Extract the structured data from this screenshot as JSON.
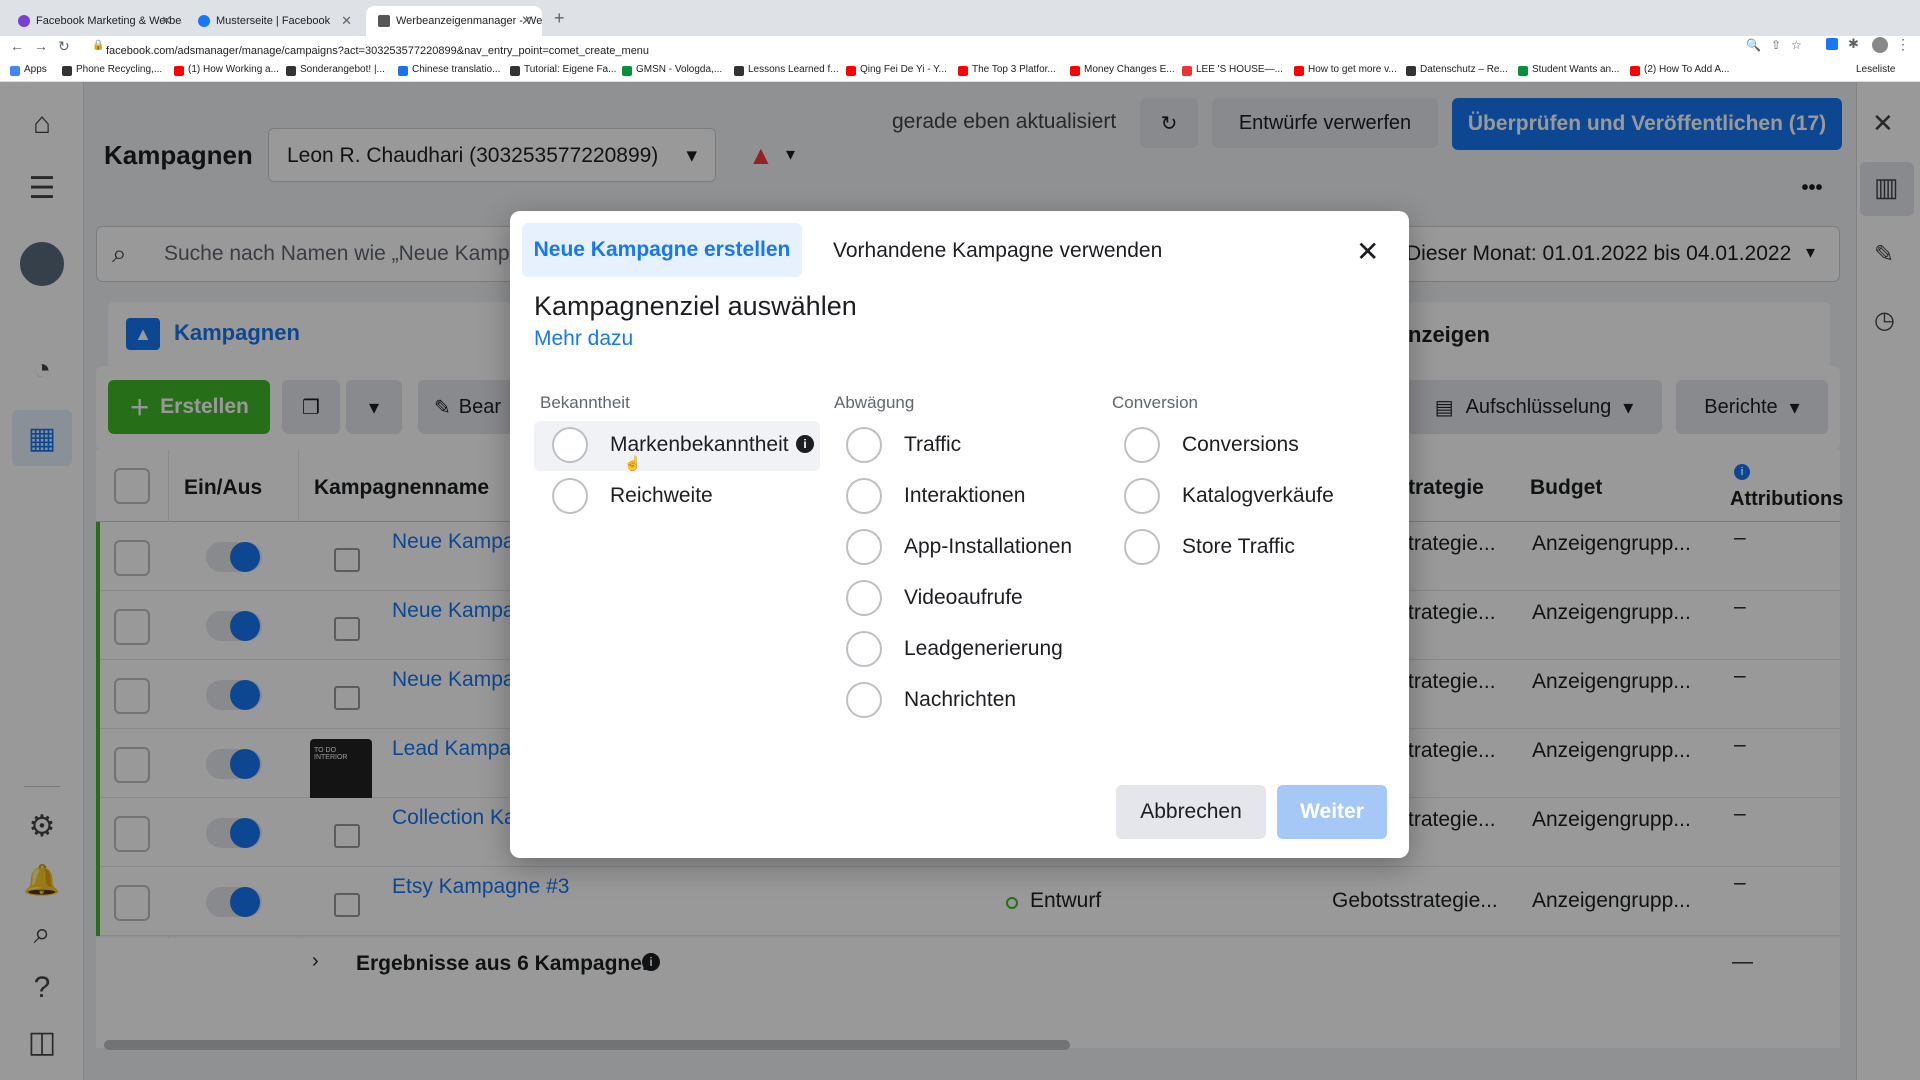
{
  "browser": {
    "tabs": [
      {
        "title": "Facebook Marketing & Werbea",
        "color": "#7a3fd0"
      },
      {
        "title": "Musterseite | Facebook",
        "color": "#1877f2"
      },
      {
        "title": "Werbeanzeigenmanager - Wer",
        "color": "#555"
      }
    ],
    "new_tab": "+",
    "url": "facebook.com/adsmanager/manage/campaigns?act=303253577220899&nav_entry_point=comet_create_menu",
    "bookmarks": [
      {
        "label": "Apps",
        "color": "#4285f4"
      },
      {
        "label": "Phone Recycling,...",
        "color": "#333"
      },
      {
        "label": "(1) How Working a...",
        "color": "#ff0000"
      },
      {
        "label": "Sonderangebot! |...",
        "color": "#333"
      },
      {
        "label": "Chinese translatio...",
        "color": "#1a73e8"
      },
      {
        "label": "Tutorial: Eigene Fa...",
        "color": "#333"
      },
      {
        "label": "GMSN - Vologda,...",
        "color": "#0a8f3c"
      },
      {
        "label": "Lessons Learned f...",
        "color": "#333"
      },
      {
        "label": "Qing Fei De Yi - Y...",
        "color": "#ff0000"
      },
      {
        "label": "The Top 3 Platfor...",
        "color": "#ff0000"
      },
      {
        "label": "Money Changes E...",
        "color": "#ff0000"
      },
      {
        "label": "LEE 'S HOUSE—...",
        "color": "#e33"
      },
      {
        "label": "How to get more v...",
        "color": "#ff0000"
      },
      {
        "label": "Datenschutz – Re...",
        "color": "#333"
      },
      {
        "label": "Student Wants an...",
        "color": "#0a8f3c"
      },
      {
        "label": "(2) How To Add A...",
        "color": "#ff0000"
      }
    ],
    "reading_list": "Leseliste"
  },
  "header": {
    "title": "Kampagnen",
    "account": "Leon R. Chaudhari (303253577220899)",
    "status": "gerade eben aktualisiert",
    "discard": "Entwürfe verwerfen",
    "publish": "Überprüfen und Veröffentlichen (17)",
    "more": "•••"
  },
  "search": {
    "placeholder": "Suche nach Namen wie „Neue Kampa",
    "date_range": "Dieser Monat: 01.01.2022 bis 04.01.2022"
  },
  "tabs": {
    "campaigns": "Kampagnen",
    "ads": "nzeigen"
  },
  "toolbar": {
    "create": "Erstellen",
    "edit": "Bear",
    "breakdown": "Aufschlüsselung",
    "reports": "Berichte"
  },
  "table": {
    "headers": {
      "onoff": "Ein/Aus",
      "name": "Kampagnenname",
      "strategy": "trategie",
      "budget": "Budget",
      "attribution": "Attributions"
    },
    "rows": [
      {
        "name": "Neue Kampa",
        "strategy": "trategie...",
        "budget": "Anzeigengrupp...",
        "attr": "–"
      },
      {
        "name": "Neue Kampa",
        "strategy": "trategie...",
        "budget": "Anzeigengrupp...",
        "attr": "–"
      },
      {
        "name": "Neue Kampa",
        "strategy": "trategie...",
        "budget": "Anzeigengrupp...",
        "attr": "–"
      },
      {
        "name": "Lead Kampa",
        "strategy": "trategie...",
        "budget": "Anzeigengrupp...",
        "attr": "–"
      },
      {
        "name": "Collection Ka",
        "strategy": "trategie...",
        "budget": "Anzeigengrupp...",
        "attr": "–"
      },
      {
        "name": "Etsy Kampagne #3",
        "status": "Entwurf",
        "strategy": "Gebotsstrategie...",
        "budget": "Anzeigengrupp...",
        "attr": "–"
      }
    ],
    "summary": "Ergebnisse aus 6 Kampagnen",
    "summary_attr": "—",
    "thumb_text": "TO DO INTERIOR"
  },
  "modal": {
    "tab_new": "Neue Kampagne erstellen",
    "tab_existing": "Vorhandene Kampagne verwenden",
    "heading": "Kampagnenziel auswählen",
    "learn_more": "Mehr dazu",
    "groups": [
      {
        "label": "Bekanntheit",
        "options": [
          "Markenbekanntheit",
          "Reichweite"
        ]
      },
      {
        "label": "Abwägung",
        "options": [
          "Traffic",
          "Interaktionen",
          "App-Installationen",
          "Videoaufrufe",
          "Leadgenerierung",
          "Nachrichten"
        ]
      },
      {
        "label": "Conversion",
        "options": [
          "Conversions",
          "Katalogverkäufe",
          "Store Traffic"
        ]
      }
    ],
    "cancel": "Abbrechen",
    "next": "Weiter"
  },
  "colors": {
    "accent": "#1877f2",
    "publish_bg": "#1877f2",
    "create_bg": "#42b72a",
    "next_disabled": "#a6c8f7"
  }
}
